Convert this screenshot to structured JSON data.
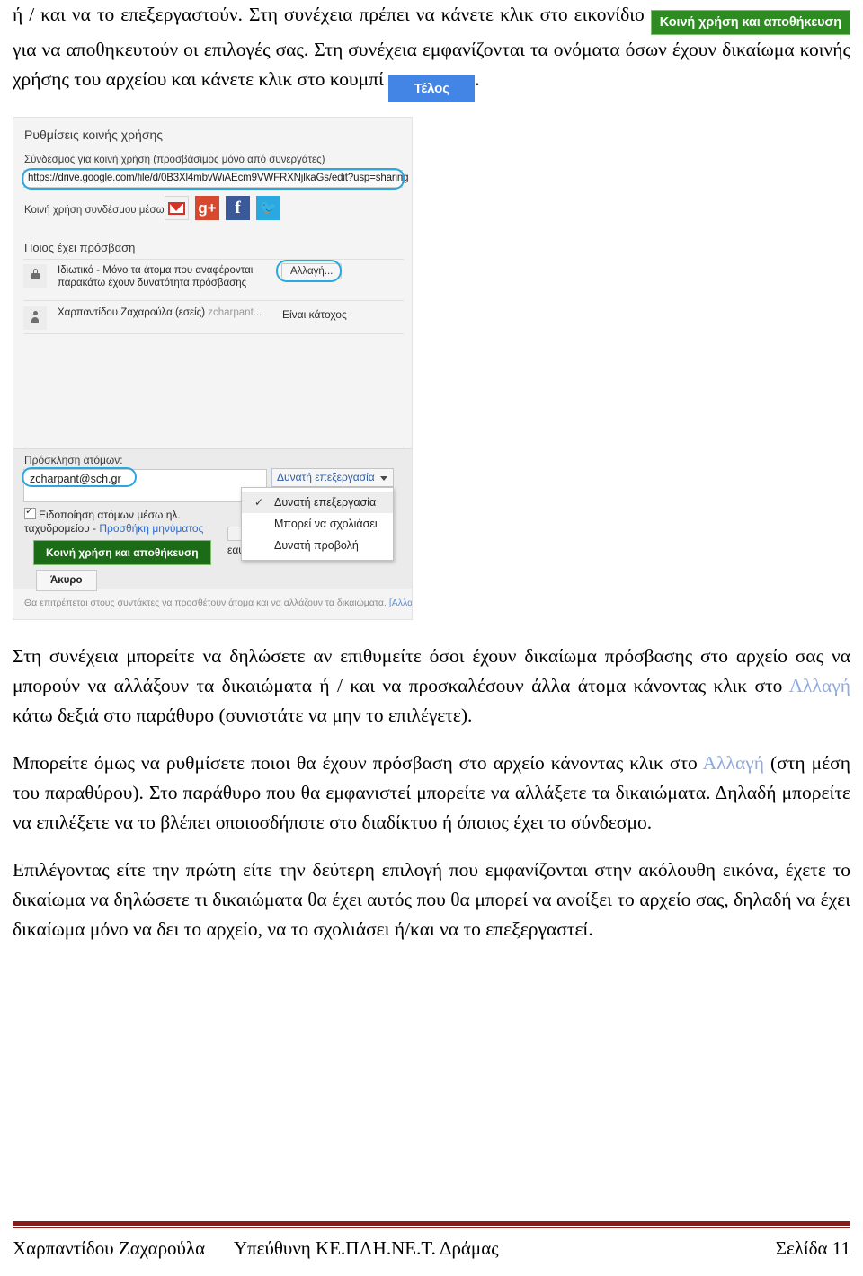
{
  "document": {
    "intro": {
      "part1": "ή / και να το επεξεργαστούν. Στη συνέχεια πρέπει να κάνετε κλικ στο εικονίδιο",
      "green_button_label": "Κοινή χρήση και αποθήκευση",
      "part2": "για να αποθηκευτούν οι επιλογές σας. Στη συνέχεια εμφανίζονται τα ονόματα όσων έχουν δικαίωμα κοινής χρήσης του αρχείου και κάνετε κλικ στο κουμπί",
      "blue_button_label": "Τέλος",
      "part3": "."
    },
    "paragraphs": [
      {
        "id": "p1",
        "segments": [
          {
            "text": "Στη συνέχεια μπορείτε να δηλώσετε αν επιθυμείτε όσοι έχουν δικαίωμα πρόσβασης στο αρχείο σας να μπορούν να αλλάξουν τα δικαιώματα ή / και να προσκαλέσουν άλλα άτομα κάνοντας κλικ στο ",
            "link": false
          },
          {
            "text": "Αλλαγή",
            "link": true
          },
          {
            "text": " κάτω δεξιά στο παράθυρο (συνιστάτε να μην το επιλέγετε).",
            "link": false
          }
        ]
      },
      {
        "id": "p2",
        "segments": [
          {
            "text": "Μπορείτε όμως να ρυθμίσετε ποιοι θα έχουν πρόσβαση στο αρχείο κάνοντας κλικ στο ",
            "link": false
          },
          {
            "text": "Αλλαγή",
            "link": true
          },
          {
            "text": " (στη μέση του παραθύρου). Στο παράθυρο που θα εμφανιστεί  μπορείτε να αλλάξετε τα δικαιώματα. Δηλαδή μπορείτε να επιλέξετε να το βλέπει οποιοσδήποτε στο διαδίκτυο ή όποιος έχει το σύνδεσμο.",
            "link": false
          }
        ]
      },
      {
        "id": "p3",
        "segments": [
          {
            "text": "Επιλέγοντας είτε την πρώτη είτε την δεύτερη επιλογή που εμφανίζονται στην ακόλουθη εικόνα, έχετε το δικαίωμα να δηλώσετε τι δικαιώματα θα έχει αυτός που θα μπορεί να ανοίξει το αρχείο σας, δηλαδή να έχει δικαίωμα μόνο να δει το αρχείο, να το σχολιάσει  ή/και να το επεξεργαστεί.",
            "link": false
          }
        ]
      }
    ]
  },
  "figure": {
    "dialog_title": "Ρυθμίσεις κοινής χρήσης",
    "link_label": "Σύνδεσμος για κοινή χρήση (προσβάσιμος μόνο από συνεργάτες)",
    "link_url": "https://drive.google.com/file/d/0B3Xl4mbvWiAEcm9VWFRXNjlkaGs/edit?usp=sharing",
    "share_via_label": "Κοινή χρήση συνδέσμου μέσω:",
    "social_icons": [
      {
        "name": "gmail-icon",
        "glyph": "M"
      },
      {
        "name": "google-plus-icon",
        "glyph": "g+"
      },
      {
        "name": "facebook-icon",
        "glyph": "f"
      },
      {
        "name": "twitter-icon",
        "glyph": "ᵕ"
      }
    ],
    "who_has_access_label": "Ποιος έχει πρόσβαση",
    "access_rows": [
      {
        "icon": "lock-icon",
        "line1": "Ιδιωτικό - Μόνο τα άτομα που αναφέρονται",
        "line2": "παρακάτω έχουν δυνατότητα πρόσβασης",
        "action": "Αλλαγή..."
      },
      {
        "icon": "person-icon",
        "name": "Χαρπαντίδου Ζαχαρούλα (εσείς)",
        "email": "zcharpant...",
        "role": "Είναι κάτοχος"
      }
    ],
    "invite_label": "Πρόσκληση ατόμων:",
    "invite_value": "zcharpant@sch.gr",
    "permission_selected": "Δυνατή επεξεργασία",
    "permission_menu": [
      {
        "label": "Δυνατή επεξεργασία",
        "checked": true,
        "tick": "✓"
      },
      {
        "label": "Μπορεί να σχολιάσει",
        "checked": false,
        "tick": ""
      },
      {
        "label": "Δυνατή προβολή",
        "checked": false,
        "tick": ""
      }
    ],
    "notify_text_line1": "Ειδοποίηση ατόμων μέσω ηλ.",
    "notify_text_line2": "ταχυδρομείου - ",
    "notify_link": "Προσθήκη μηνύματος",
    "self_copy_text": "εαυτό μου",
    "save_button": "Κοινή χρήση και αποθήκευση",
    "cancel_button": "Άκυρο",
    "footnote": "Θα επιτρέπεται στους συντάκτες να προσθέτουν άτομα και να αλλάζουν τα δικαιώματα.",
    "footnote_link": "[Αλλαγή]"
  },
  "footer": {
    "author": "Χαρπαντίδου Ζαχαρούλα",
    "role": "Υπεύθυνη ΚΕ.ΠΛΗ.ΝΕ.Τ. Δράμας",
    "page": "Σελίδα 11"
  },
  "colors": {
    "green_button": "#2E8B22",
    "blue_button": "#4285E4",
    "link_word": "#8FAADC",
    "footer_rule": "#8C1A1A",
    "highlight_ring": "#29A8E0"
  }
}
